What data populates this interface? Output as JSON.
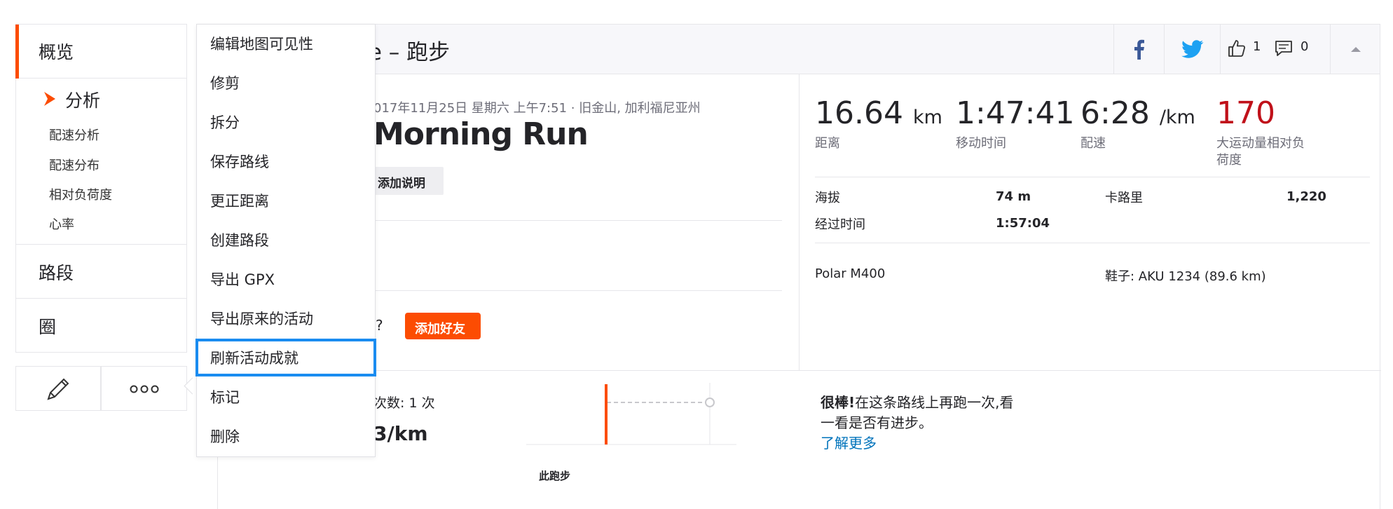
{
  "sidebar": {
    "overview": "概览",
    "analysis": "分析",
    "sub_items": [
      "配速分析",
      "配速分布",
      "相对负荷度",
      "心率"
    ],
    "segments": "路段",
    "laps": "圈"
  },
  "tools": {
    "edit_icon": "pencil-icon",
    "more_icon": "more-icon"
  },
  "menu": {
    "items": [
      "编辑地图可见性",
      "修剪",
      "拆分",
      "保存路线",
      "更正距离",
      "创建路段",
      "导出 GPX",
      "导出原来的活动",
      "刷新活动成就",
      "标记",
      "删除"
    ],
    "highlighted": "刷新活动成就",
    "highlight_color": "#1a8cf0"
  },
  "header": {
    "title": "zie – 跑步",
    "likes": "1",
    "comments": "0"
  },
  "activity": {
    "datetime": "017年11月25日 星期六 上午7:51 · 旧金山, 加利福尼亚州",
    "name": "Morning Run",
    "add_description": "添加说明",
    "with_question": "?",
    "add_friend": "添加好友"
  },
  "stats": {
    "distance": "16.64",
    "distance_unit": "km",
    "distance_label": "距离",
    "moving_time": "1:47:41",
    "moving_time_label": "移动时间",
    "pace": "6:28",
    "pace_unit": "/km",
    "pace_label": "配速",
    "relative_effort": "170",
    "relative_effort_label_1": "大运动量相对负",
    "relative_effort_label_2": "荷度"
  },
  "details": {
    "elevation_label": "海拔",
    "elevation": "74 m",
    "calories_label": "卡路里",
    "calories": "1,220",
    "elapsed_label": "经过时间",
    "elapsed": "1:57:04",
    "device": "Polar M400",
    "shoes": "鞋子: AKU 1234 (89.6 km)"
  },
  "segment_effort": {
    "count": "次数: 1 次",
    "pace": "3/km",
    "this_run": "此跑步",
    "encourage_bold": "很棒!",
    "encourage_1": "在这条路线上再跑一次,看",
    "encourage_2": "一看是否有进步。",
    "learn_more": "了解更多"
  },
  "colors": {
    "brand": "#fc4c02",
    "effort": "#c0111a",
    "link": "#0073bb",
    "facebook": "#3b5998",
    "twitter": "#1da1f2"
  }
}
